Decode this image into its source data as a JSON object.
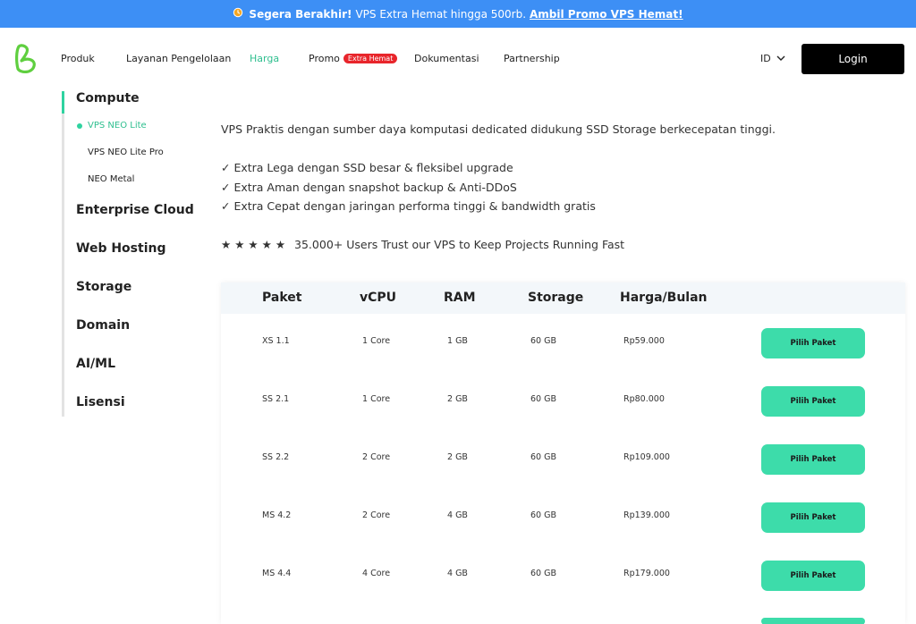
{
  "banner": {
    "icon": "clock-icon",
    "lead": "Segera Berakhir!",
    "text": "VPS Extra Hemat hingga 500rb.",
    "link": "Ambil Promo VPS Hemat!"
  },
  "nav": {
    "items": [
      "Produk",
      "Layanan Pengelolaan",
      "Harga",
      "Promo",
      "Dokumentasi",
      "Partnership"
    ],
    "active": "Harga",
    "promo_badge": "Extra Hemat",
    "lang": "ID",
    "login": "Login"
  },
  "sidebar": {
    "compute": "Compute",
    "compute_items": [
      "VPS NEO Lite",
      "VPS NEO Lite Pro",
      "NEO Metal"
    ],
    "active_item": "VPS NEO Lite",
    "categories": [
      "Enterprise Cloud",
      "Web Hosting",
      "Storage",
      "Domain",
      "AI/ML",
      "Lisensi"
    ]
  },
  "main": {
    "description": "VPS Praktis dengan sumber daya komputasi dedicated didukung SSD Storage berkecepatan tinggi.",
    "features": [
      "✓ Extra Lega dengan SSD besar & fleksibel upgrade",
      "✓ Extra Aman dengan snapshot backup & Anti-DDoS",
      "✓ Extra Cepat dengan jaringan performa tinggi & bandwidth gratis"
    ],
    "stars": "★★★★★",
    "rating_text": "35.000+ Users Trust our VPS to Keep Projects Running Fast"
  },
  "table": {
    "headers": [
      "Paket",
      "vCPU",
      "RAM",
      "Storage",
      "Harga/Bulan"
    ],
    "button_label": "Pilih Paket",
    "rows": [
      [
        "XS 1.1",
        "1 Core",
        "1 GB",
        "60 GB",
        "Rp59.000"
      ],
      [
        "SS 2.1",
        "1 Core",
        "2 GB",
        "60 GB",
        "Rp80.000"
      ],
      [
        "SS 2.2",
        "2 Core",
        "2 GB",
        "60 GB",
        "Rp109.000"
      ],
      [
        "MS 4.2",
        "2 Core",
        "4 GB",
        "60 GB",
        "Rp139.000"
      ],
      [
        "MS 4.4",
        "4 Core",
        "4 GB",
        "60 GB",
        "Rp179.000"
      ]
    ]
  },
  "colors": {
    "banner": "#3d8ff5",
    "accent": "#2fd3a0",
    "button": "#3ddcaa",
    "badge": "#e8252b",
    "login": "#000000"
  }
}
